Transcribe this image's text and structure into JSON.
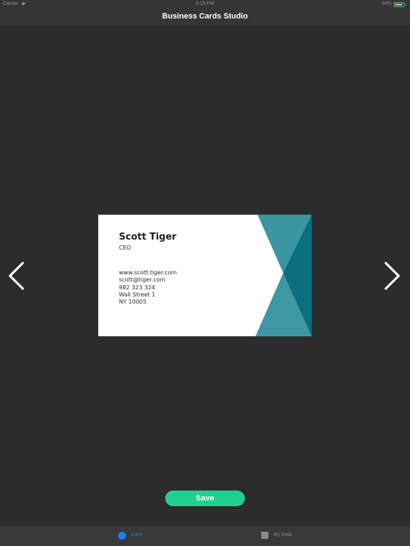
{
  "status_bar": {
    "carrier": "Carrier",
    "time": "3:15 PM",
    "battery_percent": "94%",
    "battery_level": 0.94,
    "battery_color": "#4cd964"
  },
  "nav": {
    "title": "Business Cards Studio"
  },
  "navigation": {
    "prev_icon": "chevron-left-icon",
    "next_icon": "chevron-right-icon"
  },
  "card": {
    "name": "Scott Tiger",
    "role": "CEO",
    "website": "www.scott.tiger.com",
    "email": "scott@tiger.com",
    "phone": "982 323 324",
    "street": "Wall Street 1",
    "city": "NY 10005",
    "accent_color": "#1a7f8e"
  },
  "actions": {
    "save_label": "Save",
    "save_color": "#1fd18c"
  },
  "tab_bar": {
    "items": [
      {
        "label": "Card",
        "icon": "circle-icon",
        "active": true,
        "color": "#1a7cf6"
      },
      {
        "label": "My Data",
        "icon": "square-icon",
        "active": false,
        "color": "#8a8a8a"
      }
    ]
  }
}
